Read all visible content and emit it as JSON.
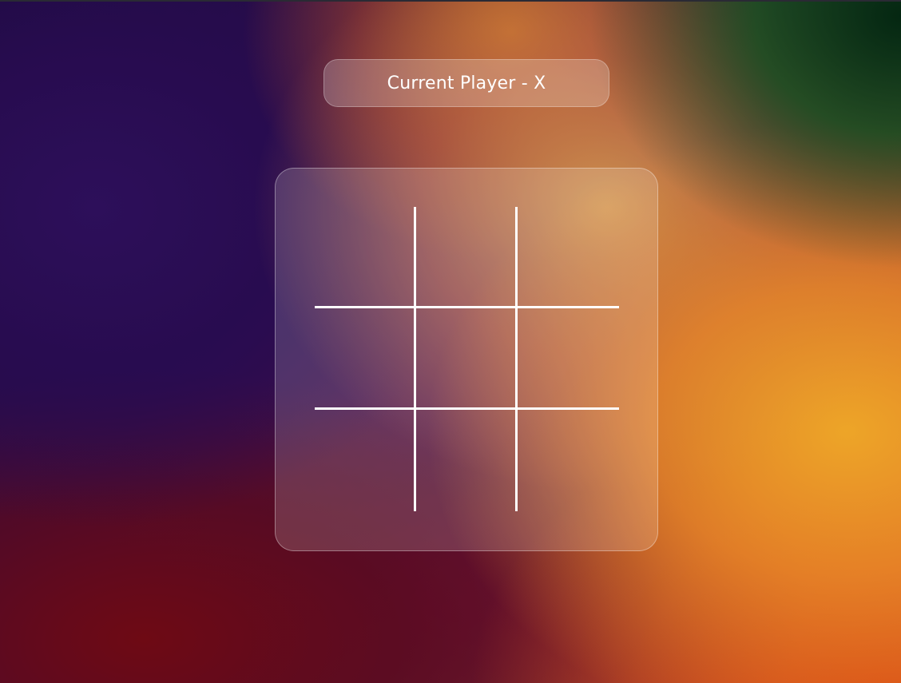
{
  "status": {
    "label": "Current Player - X"
  },
  "board": {
    "cells": [
      "",
      "",
      "",
      "",
      "",
      "",
      "",
      "",
      ""
    ]
  },
  "colors": {
    "grid_line": "#ffffff",
    "text": "#ffffff"
  }
}
